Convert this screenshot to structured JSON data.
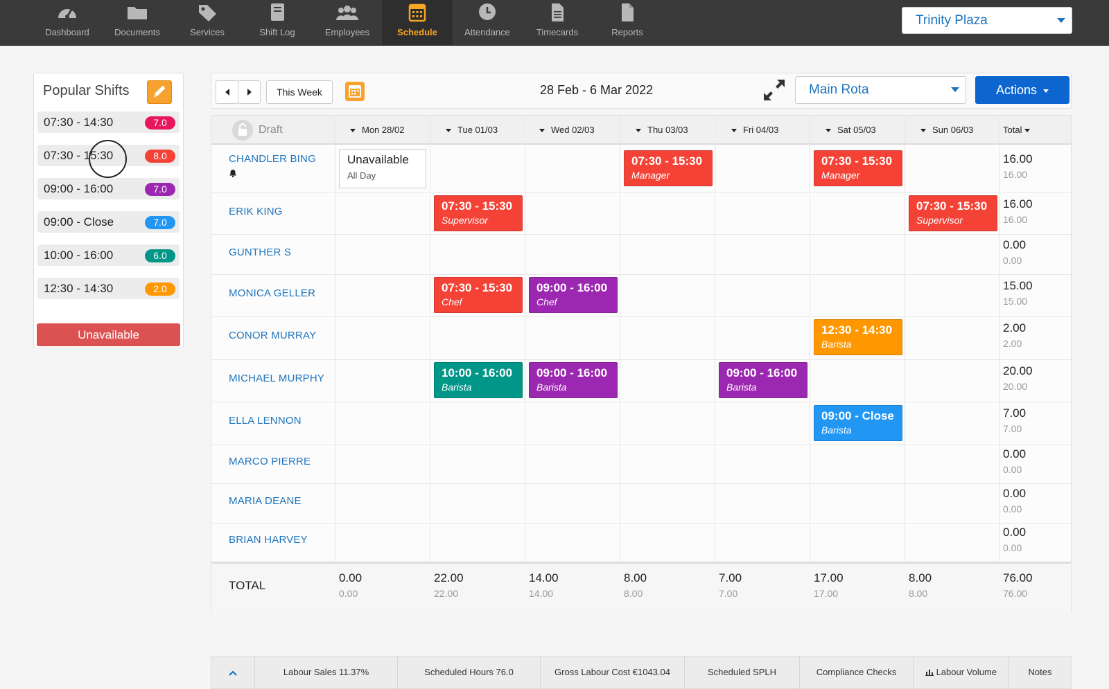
{
  "nav": {
    "items": [
      {
        "label": "Dashboard",
        "icon": "dashboard-icon"
      },
      {
        "label": "Documents",
        "icon": "folder-icon"
      },
      {
        "label": "Services",
        "icon": "tag-icon"
      },
      {
        "label": "Shift Log",
        "icon": "book-icon"
      },
      {
        "label": "Employees",
        "icon": "users-icon"
      },
      {
        "label": "Schedule",
        "icon": "calendar-icon",
        "active": true
      },
      {
        "label": "Attendance",
        "icon": "clock-icon"
      },
      {
        "label": "Timecards",
        "icon": "document-icon"
      },
      {
        "label": "Reports",
        "icon": "file-icon"
      }
    ],
    "location": "Trinity Plaza",
    "active_color": "#f5a623"
  },
  "popular": {
    "title": "Popular Shifts",
    "shifts": [
      {
        "time": "07:30 - 14:30",
        "hours": "7.0",
        "color": "#e8175d"
      },
      {
        "time": "07:30 - 15:30",
        "hours": "8.0",
        "color": "#f44336"
      },
      {
        "time": "09:00 - 16:00",
        "hours": "7.0",
        "color": "#9c27b0"
      },
      {
        "time": "09:00 - Close",
        "hours": "7.0",
        "color": "#2196f3"
      },
      {
        "time": "10:00 - 16:00",
        "hours": "6.0",
        "color": "#009688"
      },
      {
        "time": "12:30 - 14:30",
        "hours": "2.0",
        "color": "#ff9800"
      }
    ],
    "unavailable_label": "Unavailable"
  },
  "toolbar": {
    "this_week": "This Week",
    "date_range": "28 Feb - 6 Mar 2022",
    "rota": "Main Rota",
    "actions": "Actions"
  },
  "grid": {
    "draft_label": "Draft",
    "days": [
      "Mon 28/02",
      "Tue 01/03",
      "Wed 02/03",
      "Thu 03/03",
      "Fri 04/03",
      "Sat 05/03",
      "Sun 06/03"
    ],
    "total_header": "Total",
    "employees": [
      {
        "name": "CHANDLER BING",
        "total": "16.00",
        "sub": "16.00",
        "bell": true
      },
      {
        "name": "ERIK KING",
        "total": "16.00",
        "sub": "16.00"
      },
      {
        "name": "GUNTHER S",
        "total": "0.00",
        "sub": "0.00"
      },
      {
        "name": "MONICA GELLER",
        "total": "15.00",
        "sub": "15.00"
      },
      {
        "name": "CONOR MURRAY",
        "total": "2.00",
        "sub": "2.00"
      },
      {
        "name": "MICHAEL MURPHY",
        "total": "20.00",
        "sub": "20.00"
      },
      {
        "name": "ELLA LENNON",
        "total": "7.00",
        "sub": "7.00"
      },
      {
        "name": "MARCO PIERRE",
        "total": "0.00",
        "sub": "0.00"
      },
      {
        "name": "MARIA DEANE",
        "total": "0.00",
        "sub": "0.00"
      },
      {
        "name": "BRIAN HARVEY",
        "total": "0.00",
        "sub": "0.00"
      }
    ],
    "unavailable": {
      "title": "Unavailable",
      "sub": "All Day"
    },
    "shifts": [
      {
        "row": 0,
        "day": 3,
        "time": "07:30 - 15:30",
        "role": "Manager",
        "color": "#f44336"
      },
      {
        "row": 0,
        "day": 5,
        "time": "07:30 - 15:30",
        "role": "Manager",
        "color": "#f44336"
      },
      {
        "row": 1,
        "day": 1,
        "time": "07:30 - 15:30",
        "role": "Supervisor",
        "color": "#f44336"
      },
      {
        "row": 1,
        "day": 6,
        "time": "07:30 - 15:30",
        "role": "Supervisor",
        "color": "#f44336"
      },
      {
        "row": 3,
        "day": 1,
        "time": "07:30 - 15:30",
        "role": "Chef",
        "color": "#f44336"
      },
      {
        "row": 3,
        "day": 2,
        "time": "09:00 - 16:00",
        "role": "Chef",
        "color": "#9c27b0"
      },
      {
        "row": 4,
        "day": 5,
        "time": "12:30 - 14:30",
        "role": "Barista",
        "color": "#ff9800"
      },
      {
        "row": 5,
        "day": 1,
        "time": "10:00 - 16:00",
        "role": "Barista",
        "color": "#009688"
      },
      {
        "row": 5,
        "day": 2,
        "time": "09:00 - 16:00",
        "role": "Barista",
        "color": "#9c27b0"
      },
      {
        "row": 5,
        "day": 4,
        "time": "09:00 - 16:00",
        "role": "Barista",
        "color": "#9c27b0"
      },
      {
        "row": 6,
        "day": 5,
        "time": "09:00 - Close",
        "role": "Barista",
        "color": "#2196f3"
      }
    ],
    "totals": {
      "label": "TOTAL",
      "values": [
        {
          "main": "0.00",
          "sub": "0.00"
        },
        {
          "main": "22.00",
          "sub": "22.00"
        },
        {
          "main": "14.00",
          "sub": "14.00"
        },
        {
          "main": "8.00",
          "sub": "8.00"
        },
        {
          "main": "7.00",
          "sub": "7.00"
        },
        {
          "main": "17.00",
          "sub": "17.00"
        },
        {
          "main": "8.00",
          "sub": "8.00"
        },
        {
          "main": "76.00",
          "sub": "76.00"
        }
      ]
    }
  },
  "footer": {
    "items": [
      "Labour Sales 11.37%",
      "Scheduled Hours 76.0",
      "Gross Labour Cost €1043.04",
      "Scheduled SPLH",
      "Compliance Checks",
      "Labour Volume",
      "Notes"
    ]
  }
}
